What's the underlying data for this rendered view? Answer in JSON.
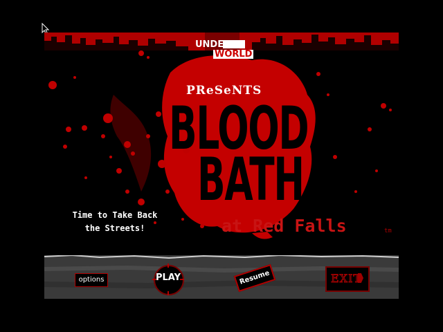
{
  "logo": {
    "line1": "UNDER",
    "line2": "WORLD"
  },
  "presents": "PReSeNTS",
  "title": {
    "line1": "BLOOD",
    "line2": "BATH"
  },
  "subtitle": "at Red Falls",
  "trademark": "tm",
  "tagline": "Time to Take Back\nthe Streets!",
  "menu": {
    "options_label": "options",
    "play_label": "PLAY",
    "resume_label": "Resume",
    "exit_label": "EXIT"
  },
  "colors": {
    "blood_red": "#c00000",
    "background": "#000000",
    "menu_bar": "#3a3a3a"
  }
}
